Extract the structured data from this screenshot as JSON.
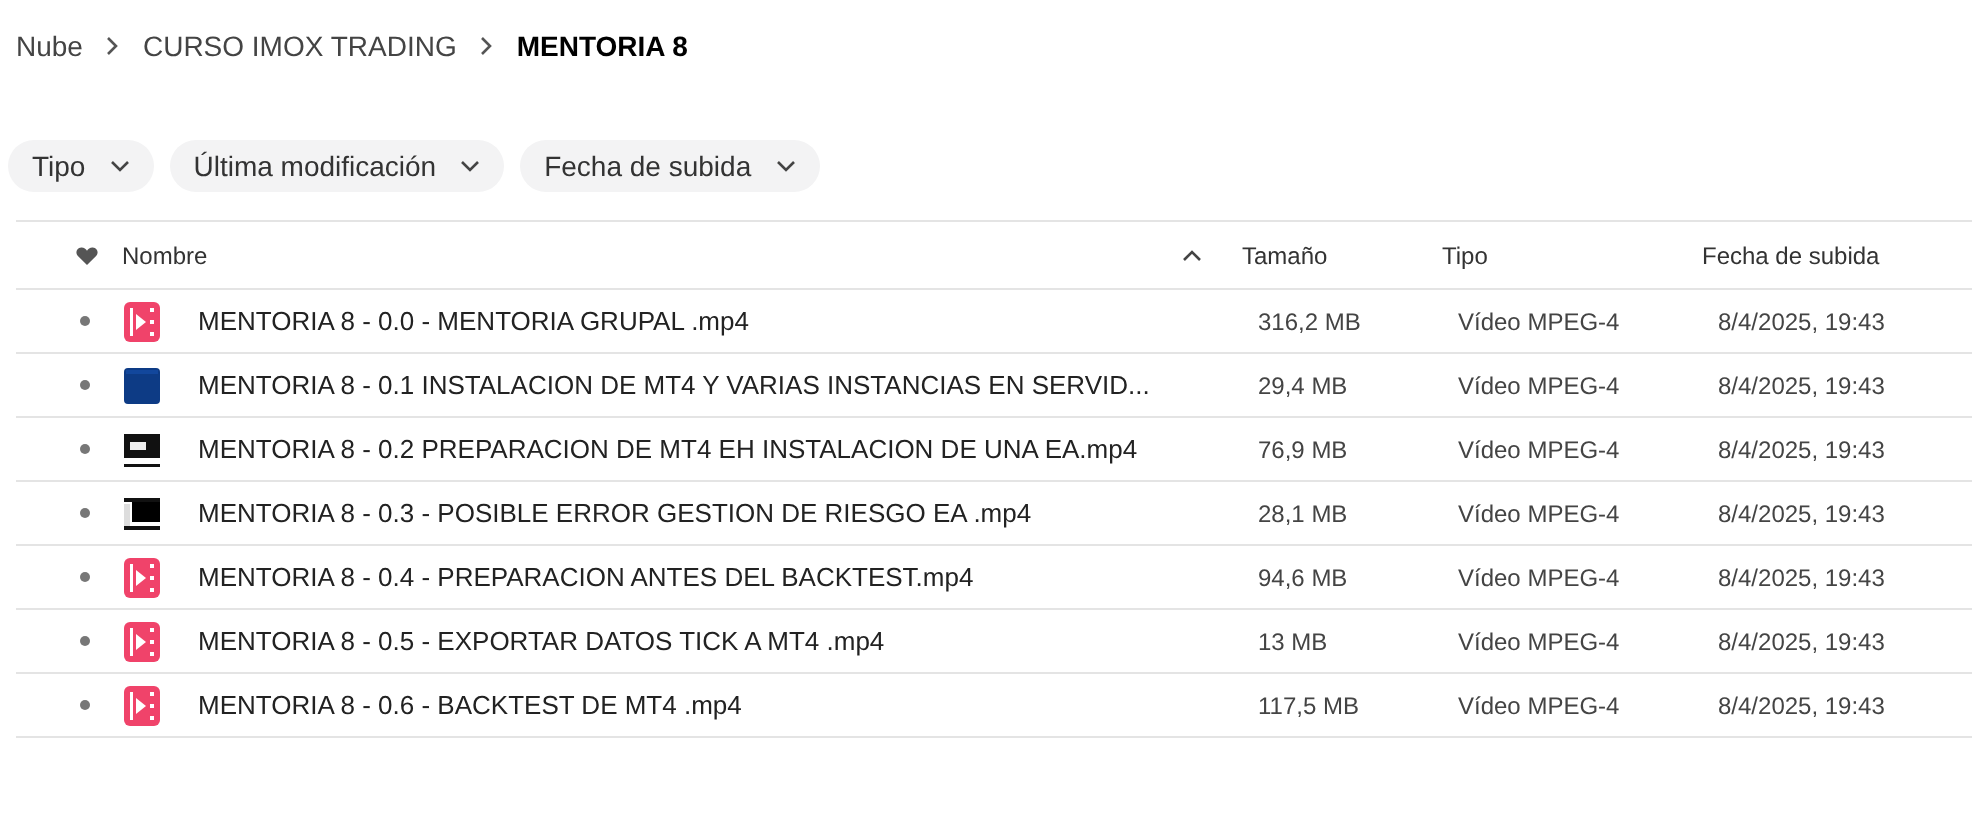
{
  "breadcrumb": [
    {
      "label": "Nube",
      "current": false
    },
    {
      "label": "CURSO IMOX TRADING",
      "current": false
    },
    {
      "label": "MENTORIA 8",
      "current": true
    }
  ],
  "filters": [
    "Tipo",
    "Última modificación",
    "Fecha de subida"
  ],
  "table": {
    "columns": [
      "Nombre",
      "Tamaño",
      "Tipo",
      "Fecha de subida"
    ],
    "rows": [
      {
        "kind": "video",
        "name": "MENTORIA 8 - 0.0 - MENTORIA GRUPAL .mp4",
        "size": "316,2 MB",
        "type": "Vídeo MPEG-4",
        "date": "8/4/2025, 19:43"
      },
      {
        "kind": "blue",
        "name": "MENTORIA 8 - 0.1 INSTALACION DE MT4 Y VARIAS INSTANCIAS EN SERVID...",
        "size": "29,4 MB",
        "type": "Vídeo MPEG-4",
        "date": "8/4/2025, 19:43"
      },
      {
        "kind": "window",
        "name": "MENTORIA 8 - 0.2 PREPARACION DE MT4 EH INSTALACION DE UNA EA.mp4",
        "size": "76,9 MB",
        "type": "Vídeo MPEG-4",
        "date": "8/4/2025, 19:43"
      },
      {
        "kind": "dark",
        "name": "MENTORIA 8 - 0.3 - POSIBLE ERROR GESTION DE RIESGO EA .mp4",
        "size": "28,1 MB",
        "type": "Vídeo MPEG-4",
        "date": "8/4/2025, 19:43"
      },
      {
        "kind": "video",
        "name": "MENTORIA 8 - 0.4 - PREPARACION ANTES DEL BACKTEST.mp4",
        "size": "94,6 MB",
        "type": "Vídeo MPEG-4",
        "date": "8/4/2025, 19:43"
      },
      {
        "kind": "video",
        "name": "MENTORIA 8 - 0.5 - EXPORTAR DATOS TICK A MT4 .mp4",
        "size": "13 MB",
        "type": "Vídeo MPEG-4",
        "date": "8/4/2025, 19:43"
      },
      {
        "kind": "video",
        "name": "MENTORIA 8 - 0.6 - BACKTEST DE MT4 .mp4",
        "size": "117,5 MB",
        "type": "Vídeo MPEG-4",
        "date": "8/4/2025, 19:43"
      }
    ]
  }
}
